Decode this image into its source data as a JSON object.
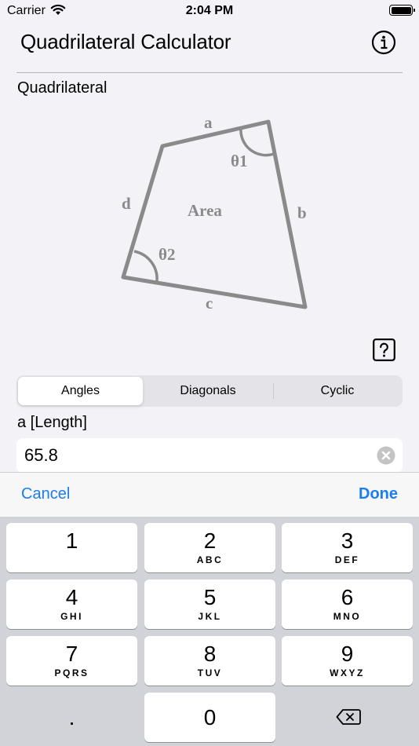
{
  "status_bar": {
    "carrier": "Carrier",
    "time": "2:04 PM"
  },
  "header": {
    "title": "Quadrilateral Calculator",
    "info_icon": "info-icon"
  },
  "section": {
    "title": "Quadrilateral"
  },
  "figure": {
    "labels": {
      "a": "a",
      "b": "b",
      "c": "c",
      "d": "d",
      "area": "Area",
      "theta1": "θ1",
      "theta2": "θ2"
    },
    "color": "#8a8a8a"
  },
  "help_icon": "question-icon",
  "segmented": {
    "tabs": [
      "Angles",
      "Diagonals",
      "Cyclic"
    ],
    "selected": "Angles"
  },
  "input": {
    "label": "a [Length]",
    "value": "65.8"
  },
  "accessory": {
    "cancel": "Cancel",
    "done": "Done"
  },
  "keypad": {
    "keys": [
      {
        "num": "1",
        "letters": ""
      },
      {
        "num": "2",
        "letters": "ABC"
      },
      {
        "num": "3",
        "letters": "DEF"
      },
      {
        "num": "4",
        "letters": "GHI"
      },
      {
        "num": "5",
        "letters": "JKL"
      },
      {
        "num": "6",
        "letters": "MNO"
      },
      {
        "num": "7",
        "letters": "PQRS"
      },
      {
        "num": "8",
        "letters": "TUV"
      },
      {
        "num": "9",
        "letters": "WXYZ"
      }
    ],
    "decimal": ".",
    "zero": "0",
    "delete_icon": "backspace-icon"
  },
  "colors": {
    "accent": "#1a7df0",
    "background": "#f2f2f7",
    "keyboard": "#d1d3d9"
  }
}
